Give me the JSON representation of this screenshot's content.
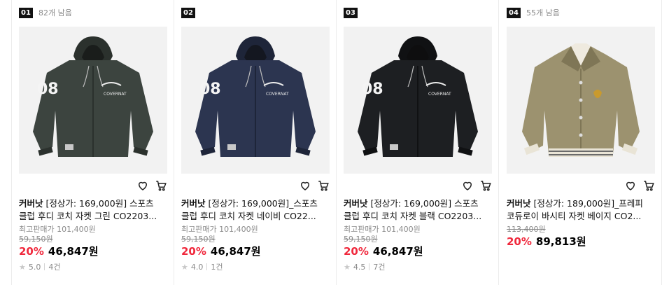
{
  "products": [
    {
      "rank": "01",
      "stock": "82개 남음",
      "brand": "커버낫",
      "title_rest": " [정상가: 169,000원] 스포츠 클럽 후디 코치 자켓 그린 CO2203...",
      "max_price": "최고판매가 101,400원",
      "orig_price": "59,150원",
      "discount": "20%",
      "price": "46,847원",
      "rating": "5.0",
      "reviews": "4건",
      "jacket_color": "#3c443f",
      "jacket_shade": "#2b312d",
      "style": "hoodie"
    },
    {
      "rank": "02",
      "stock": "",
      "brand": "커버낫",
      "title_rest": " [정상가: 169,000원]_스포츠 클럽 후디 코치 자켓 네이비 CO22...",
      "max_price": "최고판매가 101,400원",
      "orig_price": "59,150원",
      "discount": "20%",
      "price": "46,847원",
      "rating": "4.0",
      "reviews": "1건",
      "jacket_color": "#2c3550",
      "jacket_shade": "#1e2539",
      "style": "hoodie"
    },
    {
      "rank": "03",
      "stock": "",
      "brand": "커버낫",
      "title_rest": " [정상가: 169,000원] 스포츠 클럽 후디 코치 자켓 블랙 CO2203...",
      "max_price": "최고판매가 101,400원",
      "orig_price": "59,150원",
      "discount": "20%",
      "price": "46,847원",
      "rating": "4.5",
      "reviews": "7건",
      "jacket_color": "#1d1f22",
      "jacket_shade": "#101113",
      "style": "hoodie"
    },
    {
      "rank": "04",
      "stock": "55개 남음",
      "brand": "커버낫",
      "title_rest": " [정상가: 189,000원]_프레피 코듀로이 바시티 자켓 베이지 CO2...",
      "max_price": "",
      "orig_price": "113,400원",
      "discount": "20%",
      "price": "89,813원",
      "rating": "",
      "reviews": "",
      "jacket_color": "#9c926f",
      "jacket_shade": "#7f7656",
      "style": "varsity"
    }
  ],
  "colors": {
    "discount": "#f0283c",
    "muted": "#8a8a8a",
    "rank_bg": "#111111"
  },
  "icons": {
    "wishlist": "heart-icon",
    "cart": "cart-icon",
    "rating": "star-icon"
  }
}
